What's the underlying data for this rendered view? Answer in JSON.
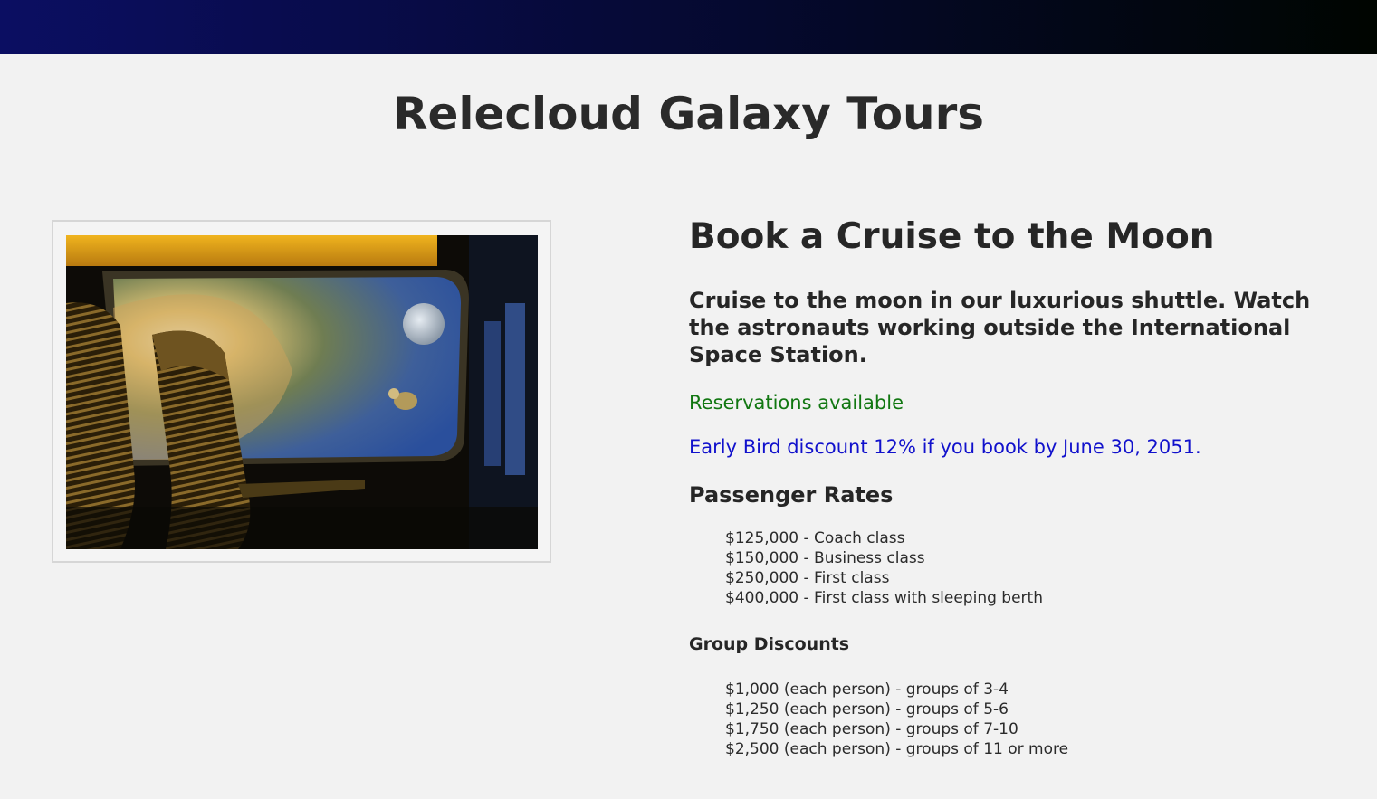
{
  "header": {
    "site_title": "Relecloud Galaxy Tours"
  },
  "hero_image": {
    "alt": "View from a shuttle cabin window of a planet, the moon and an astronaut in space",
    "icon": "shuttle-window-photo"
  },
  "main": {
    "heading": "Book a Cruise to the Moon",
    "description": "Cruise to the moon in our luxurious shuttle. Watch the astronauts working outside the International Space Station.",
    "availability": "Reservations available",
    "discount": "Early Bird discount 12% if you book by June 30, 2051.",
    "rates_heading": "Passenger Rates",
    "rates": [
      "$125,000 - Coach class",
      "$150,000 - Business class",
      "$250,000 - First class",
      "$400,000 - First class with sleeping berth"
    ],
    "group_heading": "Group Discounts",
    "group_discounts": [
      "$1,000 (each person) - groups of 3-4",
      "$1,250 (each person) - groups of 5-6",
      "$1,750 (each person) - groups of 7-10",
      "$2,500 (each person) - groups of 11 or more"
    ]
  },
  "colors": {
    "banner_start": "#0b0e62",
    "banner_end": "#000500",
    "availability_text": "#117711",
    "discount_text": "#1111cc",
    "page_background": "#f2f2f2"
  }
}
